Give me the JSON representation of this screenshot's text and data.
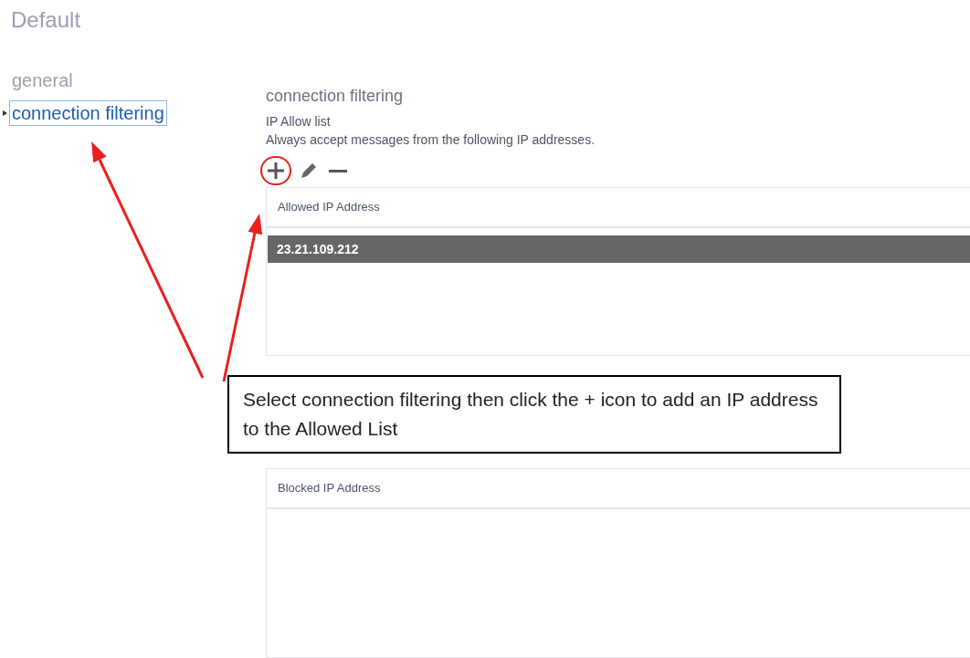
{
  "title": "Default",
  "nav": [
    {
      "label": "general",
      "selected": false
    },
    {
      "label": "connection filtering",
      "selected": true
    }
  ],
  "panel": {
    "heading": "connection filtering",
    "list_title": "IP Allow list",
    "description": "Always accept messages from the following IP addresses.",
    "toolbar": [
      {
        "kind": "add",
        "highlighted": true
      },
      {
        "kind": "edit",
        "highlighted": false
      },
      {
        "kind": "remove",
        "highlighted": false
      }
    ],
    "allowed": {
      "column": "Allowed IP Address",
      "rows": [
        {
          "value": "23.21.109.212",
          "selected": true
        }
      ]
    },
    "callout": "Select connection filtering then click the + icon to add an IP address to the Allowed List",
    "blocked": {
      "column": "Blocked IP Address"
    }
  }
}
